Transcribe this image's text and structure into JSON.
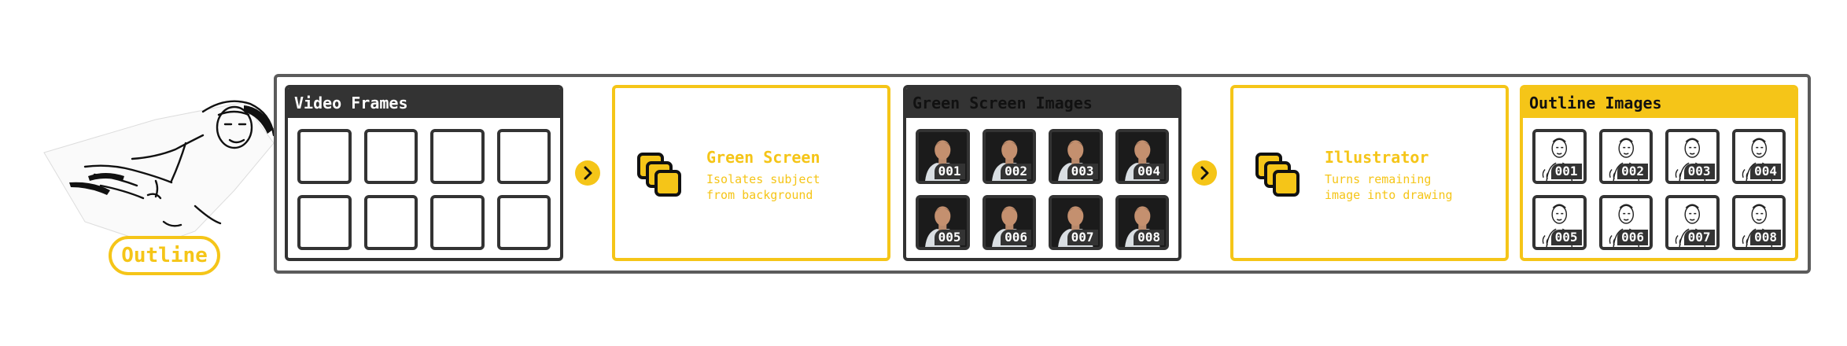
{
  "label": {
    "text": "Outline"
  },
  "panels": {
    "video_frames": {
      "title": "Video Frames",
      "cells": 8
    },
    "green_screen_step": {
      "title": "Green Screen",
      "desc": "Isolates subject\nfrom background",
      "icon": "stacked-squares-icon"
    },
    "green_screen_images": {
      "title": "Green Screen Images",
      "numbers": [
        "001",
        "002",
        "003",
        "004",
        "005",
        "006",
        "007",
        "008"
      ]
    },
    "illustrator_step": {
      "title": "Illustrator",
      "desc": "Turns remaining\nimage into drawing",
      "icon": "stacked-squares-icon"
    },
    "outline_images": {
      "title": "Outline Images",
      "numbers": [
        "001",
        "002",
        "003",
        "004",
        "005",
        "006",
        "007",
        "008"
      ]
    }
  },
  "arrows": [
    "chevron-right-icon",
    "chevron-right-icon"
  ],
  "colors": {
    "accent": "#f5c518",
    "dark": "#333333",
    "frame": "#5b5b5b"
  }
}
